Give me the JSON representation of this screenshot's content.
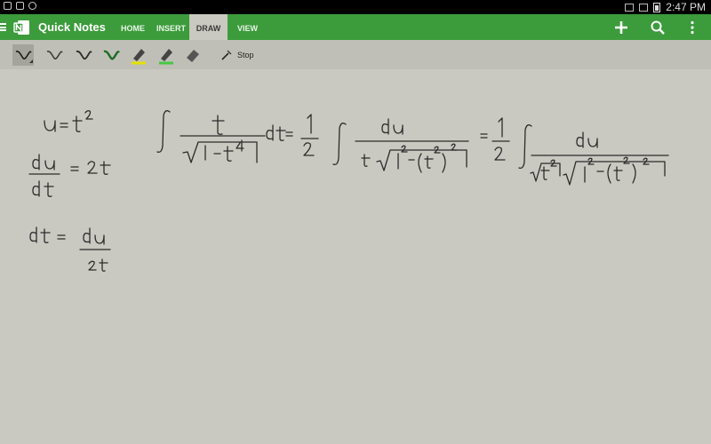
{
  "status_bar": {
    "time": "2:47 PM"
  },
  "app": {
    "title": "Quick Notes"
  },
  "ribbon": {
    "tabs": [
      {
        "label": "HOME"
      },
      {
        "label": "INSERT"
      },
      {
        "label": "DRAW"
      },
      {
        "label": "VIEW"
      }
    ],
    "active_tab": "DRAW"
  },
  "actions": {
    "add_icon": "plus-icon",
    "search_icon": "search-icon",
    "menu_icon": "kebab-icon"
  },
  "draw_toolbar": {
    "tools": [
      {
        "icon": "pen-black-icon",
        "color": "#1a1a1a"
      },
      {
        "icon": "pen-gray-icon",
        "color": "#3b3b3b"
      },
      {
        "icon": "pen-dark-icon",
        "color": "#2a2a2a"
      },
      {
        "icon": "pen-green-icon",
        "color": "#1e6b22"
      },
      {
        "icon": "highlighter-yellow-icon",
        "color": "#e6e000"
      },
      {
        "icon": "highlighter-green-icon",
        "color": "#46c846"
      },
      {
        "icon": "eraser-icon",
        "color": "#555555"
      }
    ],
    "stop_label": "Stop"
  },
  "colors": {
    "accent": "#3c9b3b",
    "canvas": "#c9c9c1",
    "ink": "#2b2b2b"
  }
}
